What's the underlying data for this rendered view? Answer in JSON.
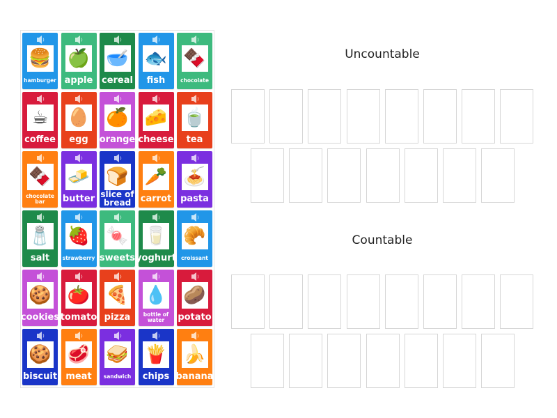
{
  "colors": {
    "blue": "#2196e8",
    "green": "#3dba7e",
    "dark_green": "#1e8a4a",
    "red": "#d81b3c",
    "orange_red": "#e8401c",
    "orange": "#ff7f11",
    "purple": "#7b2fe0",
    "magenta": "#c451d8",
    "dark_blue": "#1a35c8"
  },
  "cards": [
    {
      "label": "hamburger",
      "color": "blue",
      "icon": "hamburger-icon",
      "glyph": "🍔",
      "size": "small"
    },
    {
      "label": "apple",
      "color": "green",
      "icon": "apple-icon",
      "glyph": "🍏",
      "size": "big"
    },
    {
      "label": "cereal",
      "color": "dark_green",
      "icon": "cereal-icon",
      "glyph": "🥣",
      "size": "big"
    },
    {
      "label": "fish",
      "color": "blue",
      "icon": "fish-icon",
      "glyph": "🐟",
      "size": "big"
    },
    {
      "label": "chocolate",
      "color": "green",
      "icon": "chocolate-icon",
      "glyph": "🍫",
      "size": "small"
    },
    {
      "label": "coffee",
      "color": "red",
      "icon": "coffee-icon",
      "glyph": "☕",
      "size": "big"
    },
    {
      "label": "egg",
      "color": "orange_red",
      "icon": "egg-icon",
      "glyph": "🥚",
      "size": "big"
    },
    {
      "label": "orange",
      "color": "magenta",
      "icon": "orange-icon",
      "glyph": "🍊",
      "size": "big"
    },
    {
      "label": "cheese",
      "color": "red",
      "icon": "cheese-icon",
      "glyph": "🧀",
      "size": "big"
    },
    {
      "label": "tea",
      "color": "orange_red",
      "icon": "tea-icon",
      "glyph": "🍵",
      "size": "big"
    },
    {
      "label": "chocolate bar",
      "color": "orange",
      "icon": "chocolate-bar-icon",
      "glyph": "🍫",
      "size": "two-small"
    },
    {
      "label": "butter",
      "color": "purple",
      "icon": "butter-icon",
      "glyph": "🧈",
      "size": "big"
    },
    {
      "label": "slice of bread",
      "color": "dark_blue",
      "icon": "bread-icon",
      "glyph": "🍞",
      "size": "two"
    },
    {
      "label": "carrot",
      "color": "orange",
      "icon": "carrot-icon",
      "glyph": "🥕",
      "size": "big"
    },
    {
      "label": "pasta",
      "color": "purple",
      "icon": "pasta-icon",
      "glyph": "🍝",
      "size": "big"
    },
    {
      "label": "salt",
      "color": "dark_green",
      "icon": "salt-icon",
      "glyph": "🧂",
      "size": "big"
    },
    {
      "label": "strawberry",
      "color": "blue",
      "icon": "strawberry-icon",
      "glyph": "🍓",
      "size": "small"
    },
    {
      "label": "sweets",
      "color": "green",
      "icon": "sweets-icon",
      "glyph": "🍬",
      "size": "big"
    },
    {
      "label": "yoghurt",
      "color": "dark_green",
      "icon": "yoghurt-icon",
      "glyph": "🥛",
      "size": "big"
    },
    {
      "label": "croissant",
      "color": "blue",
      "icon": "croissant-icon",
      "glyph": "🥐",
      "size": "small"
    },
    {
      "label": "cookies",
      "color": "magenta",
      "icon": "cookies-icon",
      "glyph": "🍪",
      "size": "big"
    },
    {
      "label": "tomato",
      "color": "red",
      "icon": "tomato-icon",
      "glyph": "🍅",
      "size": "big"
    },
    {
      "label": "pizza",
      "color": "orange_red",
      "icon": "pizza-icon",
      "glyph": "🍕",
      "size": "big"
    },
    {
      "label": "bottle of water",
      "color": "magenta",
      "icon": "water-bottle-icon",
      "glyph": "💧",
      "size": "two-small"
    },
    {
      "label": "potato",
      "color": "red",
      "icon": "potato-icon",
      "glyph": "🥔",
      "size": "big"
    },
    {
      "label": "biscuit",
      "color": "dark_blue",
      "icon": "biscuit-icon",
      "glyph": "🍪",
      "size": "big"
    },
    {
      "label": "meat",
      "color": "orange",
      "icon": "meat-icon",
      "glyph": "🥩",
      "size": "big"
    },
    {
      "label": "sandwich",
      "color": "purple",
      "icon": "sandwich-icon",
      "glyph": "🥪",
      "size": "small"
    },
    {
      "label": "chips",
      "color": "dark_blue",
      "icon": "chips-icon",
      "glyph": "🍟",
      "size": "big"
    },
    {
      "label": "banana",
      "color": "orange",
      "icon": "banana-icon",
      "glyph": "🍌",
      "size": "big"
    }
  ],
  "groups": [
    {
      "title": "Uncountable",
      "slots_row1": 8,
      "slots_row2": 7
    },
    {
      "title": "Countable",
      "slots_row1": 8,
      "slots_row2": 7
    }
  ]
}
